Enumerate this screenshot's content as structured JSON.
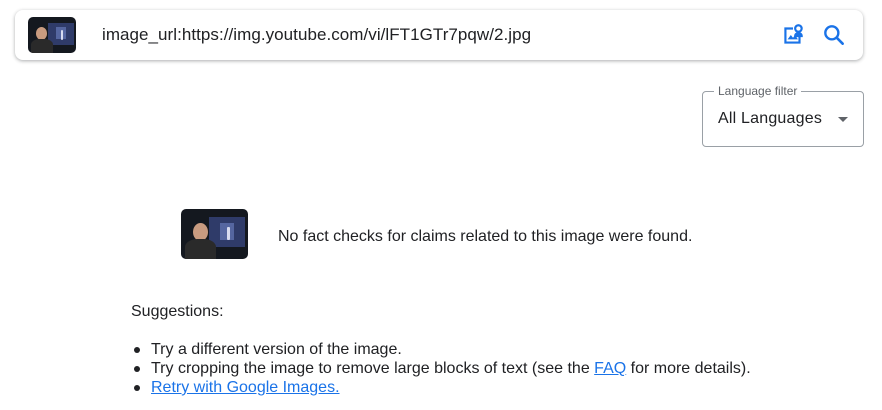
{
  "search": {
    "query": "image_url:https://img.youtube.com/vi/lFT1GTr7pqw/2.jpg",
    "thumbnail_icon": "video-thumbnail-image",
    "image_search_icon": "image-search-icon",
    "search_icon": "search-icon"
  },
  "language_filter": {
    "legend": "Language filter",
    "selected": "All Languages",
    "dropdown_icon": "caret-down-icon"
  },
  "result": {
    "message": "No fact checks for claims related to this image were found.",
    "thumbnail_icon": "video-thumbnail-image"
  },
  "suggestions": {
    "title": "Suggestions:",
    "item1": "Try a different version of the image.",
    "item2_before": "Try cropping the image to remove large blocks of text (see the ",
    "item2_link": "FAQ",
    "item2_after": " for more details).",
    "item3_link": "Retry with Google Images."
  },
  "colors": {
    "link": "#1a73e8",
    "icon_blue": "#1a73e8",
    "text": "#202124",
    "border": "#9aa0a6"
  }
}
